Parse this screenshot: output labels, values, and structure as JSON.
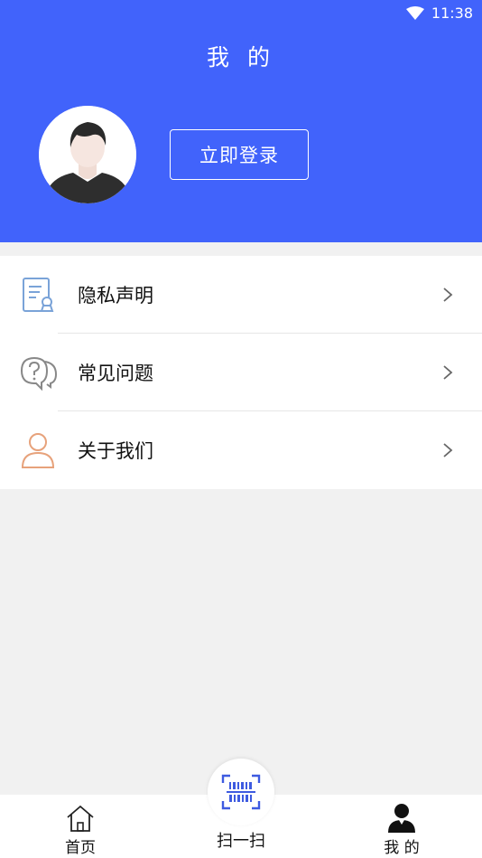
{
  "status_bar": {
    "time": "11:38"
  },
  "header": {
    "title": "我 的",
    "login_label": "立即登录"
  },
  "menu": {
    "items": [
      {
        "label": "隐私声明",
        "icon": "privacy-document-icon"
      },
      {
        "label": "常见问题",
        "icon": "faq-chat-icon"
      },
      {
        "label": "关于我们",
        "icon": "about-user-icon"
      }
    ]
  },
  "tabbar": {
    "home_label": "首页",
    "scan_label": "扫一扫",
    "mine_label": "我 的"
  },
  "colors": {
    "brand": "#4163fb",
    "background": "#f1f1f1"
  }
}
